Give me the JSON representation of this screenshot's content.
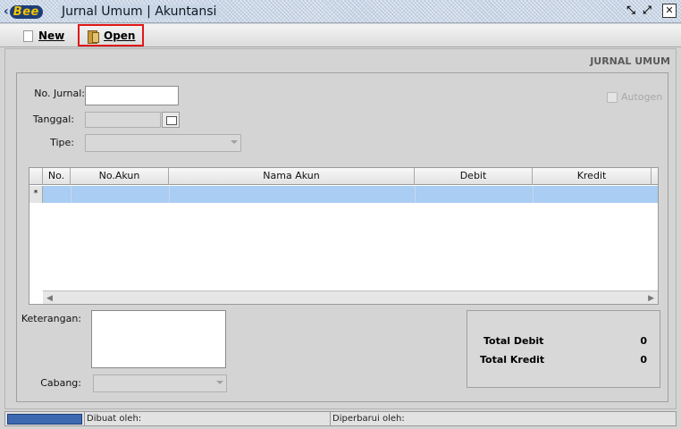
{
  "window": {
    "logo_text": "Bee",
    "title": "Jurnal Umum | Akuntansi",
    "restore_glyph": "⤡",
    "maximize_glyph": "⤢",
    "close_glyph": "✕"
  },
  "toolbar": {
    "new_label": "New",
    "open_label": "Open"
  },
  "form": {
    "heading": "JURNAL UMUM",
    "no_jurnal_label": "No. Jurnal:",
    "no_jurnal_value": "",
    "tanggal_label": "Tanggal:",
    "tanggal_value": "",
    "tipe_label": "Tipe:",
    "tipe_value": "",
    "autogen_label": "Autogen",
    "autogen_checked": false
  },
  "grid": {
    "columns": [
      "No.",
      "No.Akun",
      "Nama Akun",
      "Debit",
      "Kredit"
    ],
    "new_row_marker": "*",
    "rows": []
  },
  "footer": {
    "keterangan_label": "Keterangan:",
    "keterangan_value": "",
    "cabang_label": "Cabang:",
    "cabang_value": ""
  },
  "totals": {
    "debit_label": "Total Debit",
    "debit_value": "0",
    "kredit_label": "Total Kredit",
    "kredit_value": "0"
  },
  "status": {
    "dibuat_label": "Dibuat oleh:",
    "diperbarui_label": "Diperbarui oleh:"
  },
  "colors": {
    "selected_row": "#a9cdf3",
    "highlight_box": "#e01818",
    "progress": "#3d69b0"
  }
}
